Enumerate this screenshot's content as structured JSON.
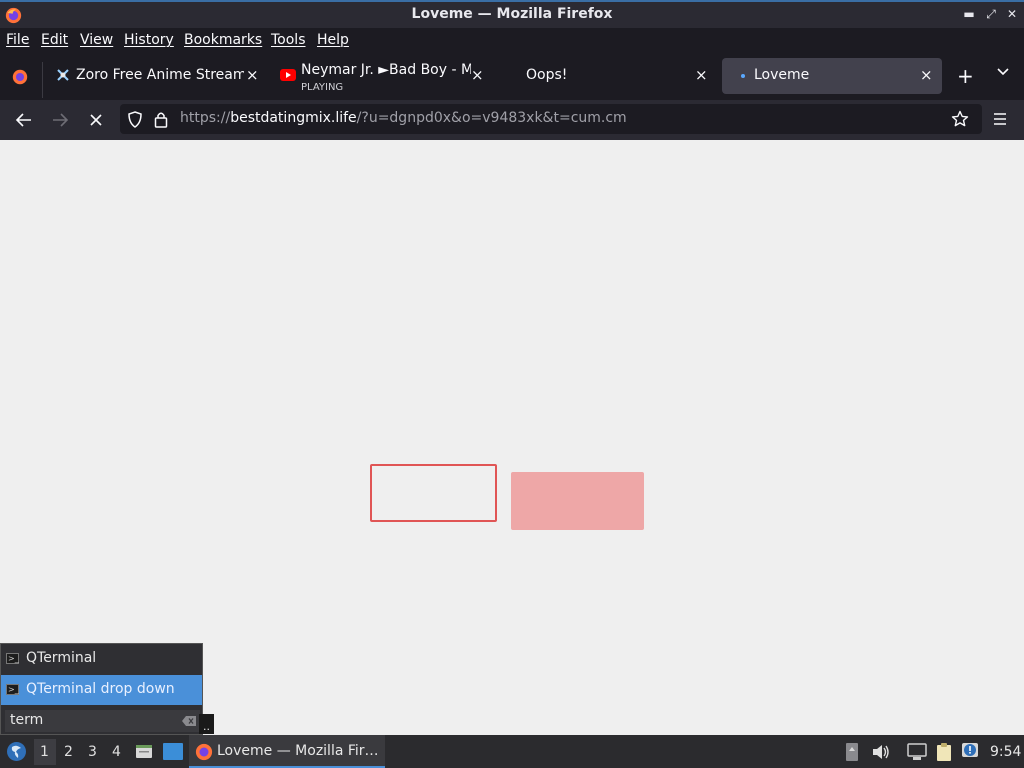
{
  "window": {
    "title": "Loveme — Mozilla Firefox",
    "controls": [
      "minimize",
      "maximize",
      "close"
    ]
  },
  "menu": [
    "File",
    "Edit",
    "View",
    "History",
    "Bookmarks",
    "Tools",
    "Help"
  ],
  "tabs": [
    {
      "label": "Zoro Free Anime Streamin",
      "icon": "zoro-favicon-icon",
      "close": "×"
    },
    {
      "label": "Neymar Jr. ►Bad Boy - Ma",
      "sub": "PLAYING",
      "icon": "youtube-icon",
      "close": "×"
    },
    {
      "label": "Oops!",
      "close": "×"
    },
    {
      "label": "Loveme",
      "close": "×",
      "active": true
    }
  ],
  "tabstrip": {
    "new_tab": "+",
    "list_tabs": "⌄"
  },
  "urlbar": {
    "scheme": "https://",
    "domain": "bestdatingmix.life",
    "path": "/?u=dgnpd0x&o=v9483xk&t=cum.cm"
  },
  "page": {
    "colors": {
      "background": "#efefef",
      "outline_box": "#e05555",
      "filled_box": "#eea7a7"
    }
  },
  "launcher": {
    "items": [
      "QTerminal",
      "QTerminal drop down"
    ],
    "selected_index": 1,
    "search_value": "term",
    "tooltip": ".."
  },
  "taskbar": {
    "workspaces": [
      "1",
      "2",
      "3",
      "4"
    ],
    "active_workspace": "1",
    "task_label": "Loveme — Mozilla Fir…",
    "clock": "9:54"
  }
}
